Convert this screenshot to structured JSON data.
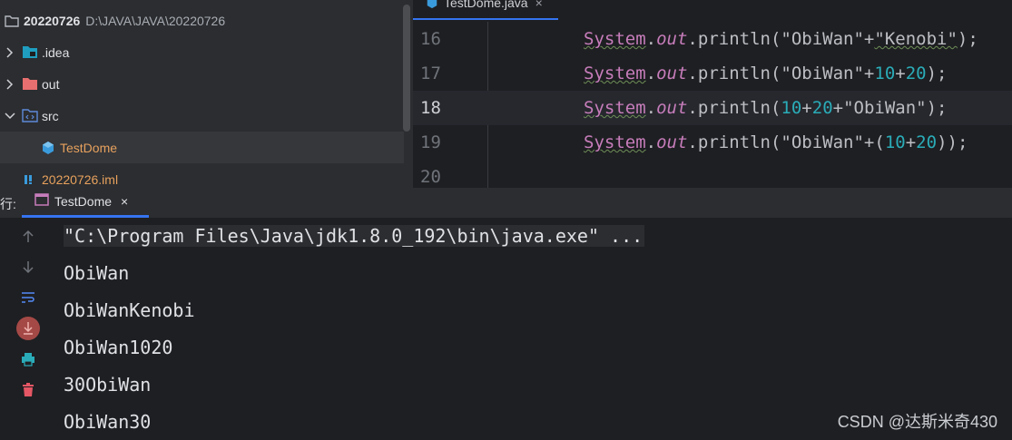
{
  "project": {
    "root": {
      "name": "20220726",
      "path": "D:\\JAVA\\JAVA\\20220726",
      "icon": "folder-icon"
    },
    "items": [
      {
        "label": ".idea",
        "icon": "idea-folder-icon"
      },
      {
        "label": "out",
        "icon": "folder-red-icon"
      },
      {
        "label": "src",
        "icon": "source-folder-icon"
      },
      {
        "label": "TestDome",
        "icon": "java-class-icon"
      },
      {
        "label": "20220726.iml",
        "icon": "iml-file-icon"
      }
    ]
  },
  "editor": {
    "tab": {
      "label": "TestDome.java",
      "close": "×"
    },
    "lines": [
      {
        "num": "16",
        "current": false
      },
      {
        "num": "17",
        "current": false
      },
      {
        "num": "18",
        "current": true
      },
      {
        "num": "19",
        "current": false
      },
      {
        "num": "20",
        "current": false
      }
    ],
    "code": {
      "sys": "System",
      "dot": ".",
      "out": "out",
      "println": "println",
      "l16": {
        "open": "(",
        "s1": "\"ObiWan\"",
        "plus": "+",
        "s2": "\"Kenobi\"",
        "close": ");"
      },
      "l17": {
        "open": "(",
        "s1": "\"ObiWan\"",
        "p1": "+",
        "n1": "10",
        "p2": "+",
        "n2": "20",
        "close": ");"
      },
      "l18": {
        "open": "(",
        "n1": "10",
        "p1": "+",
        "n2": "20",
        "p2": "+",
        "s1": "\"ObiWan\"",
        "close": ");"
      },
      "l19": {
        "open": "(",
        "s1": "\"ObiWan\"",
        "p1": "+",
        "paren": "(",
        "n1": "10",
        "p2": "+",
        "n2": "20",
        "close": "));"
      }
    }
  },
  "run": {
    "label": "行:",
    "tab": {
      "label": "TestDome",
      "close": "×",
      "icon": "console-icon"
    },
    "toolbar": [
      {
        "icon": "arrow-up-icon"
      },
      {
        "icon": "arrow-down-icon"
      },
      {
        "icon": "soft-wrap-icon"
      },
      {
        "icon": "scroll-to-end-icon"
      },
      {
        "icon": "print-icon"
      },
      {
        "icon": "trash-icon"
      }
    ],
    "console": [
      "\"C:\\Program Files\\Java\\jdk1.8.0_192\\bin\\java.exe\" ...",
      "ObiWan",
      "ObiWanKenobi",
      "ObiWan1020",
      "30ObiWan",
      "ObiWan30"
    ]
  },
  "watermark": "CSDN @达斯米奇430",
  "colors": {
    "accent": "#3574f0",
    "string": "#6aab73",
    "number": "#2aacb8",
    "keyword": "#c77dbb",
    "orange": "#e8a15d"
  }
}
